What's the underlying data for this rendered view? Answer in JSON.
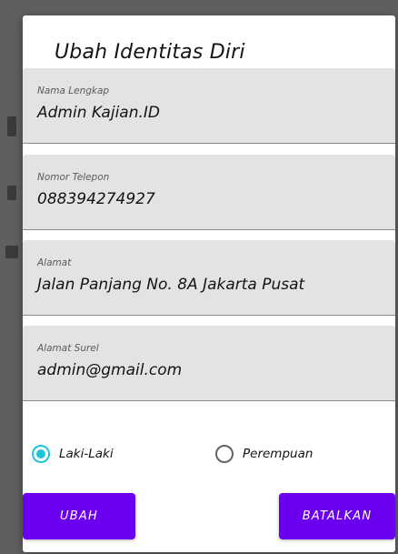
{
  "dialog": {
    "title": "Ubah Identitas Diri"
  },
  "fields": [
    {
      "label": "Nama Lengkap",
      "value": "Admin Kajian.ID"
    },
    {
      "label": "Nomor Telepon",
      "value": "088394274927"
    },
    {
      "label": "Alamat",
      "value": "Jalan Panjang No. 8A Jakarta Pusat"
    },
    {
      "label": "Alamat Surel",
      "value": "admin@gmail.com"
    }
  ],
  "gender": {
    "options": [
      {
        "label": "Laki-Laki",
        "checked": true
      },
      {
        "label": "Perempuan",
        "checked": false
      }
    ]
  },
  "buttons": {
    "submit_label": "UBAH",
    "cancel_label": "BATALKAN"
  },
  "colors": {
    "primary": "#6a00ee",
    "radio_accent": "#1cc6d9",
    "field_background": "#e3e3e3"
  }
}
